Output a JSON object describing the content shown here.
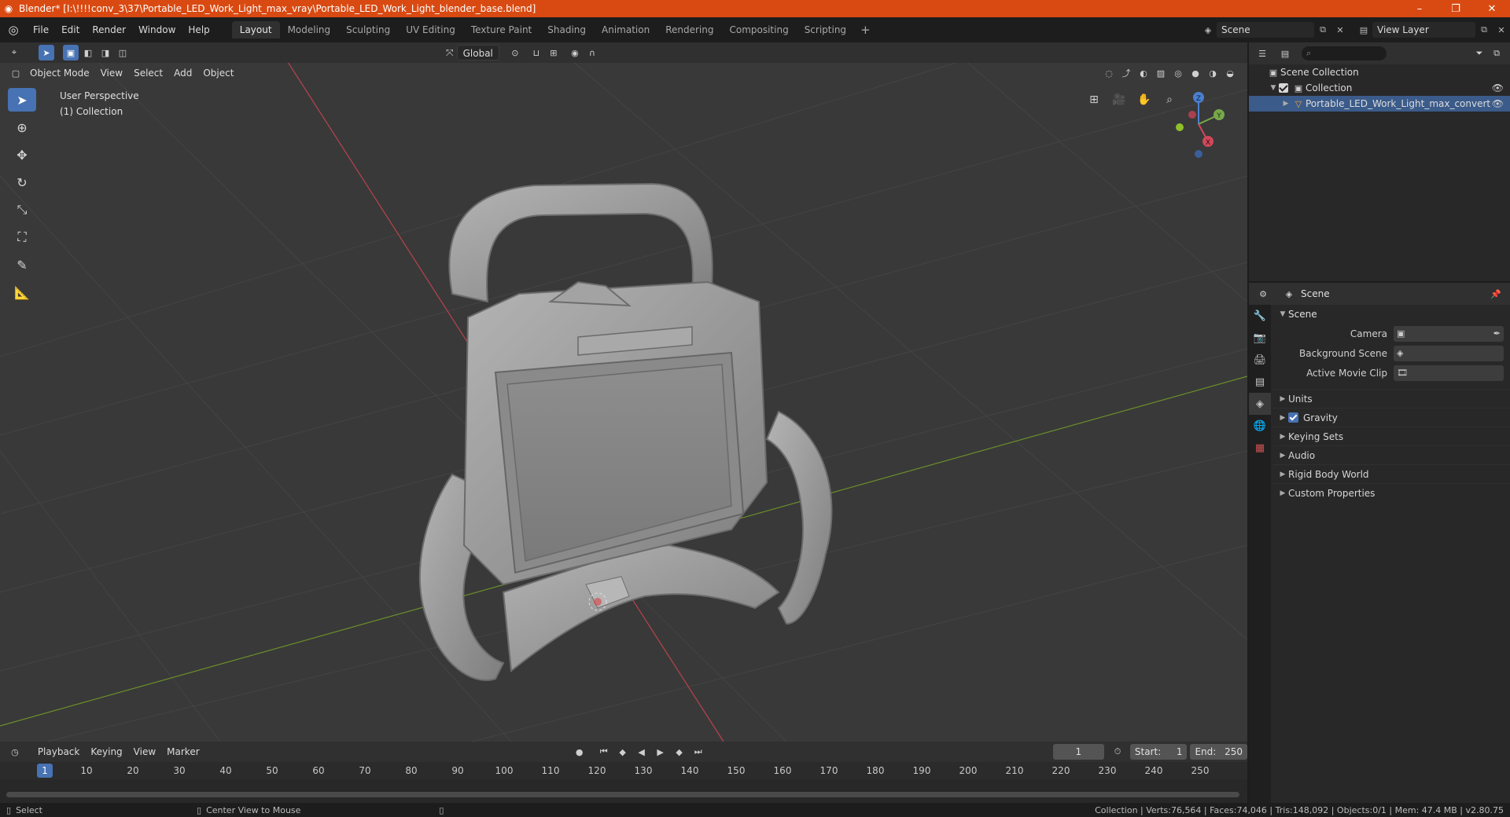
{
  "window": {
    "title": "Blender* [I:\\!!!!conv_3\\37\\Portable_LED_Work_Light_max_vray\\Portable_LED_Work_Light_blender_base.blend]",
    "minimize": "–",
    "maximize": "❐",
    "close": "✕"
  },
  "menu": {
    "items": [
      "File",
      "Edit",
      "Render",
      "Window",
      "Help"
    ]
  },
  "workspaces": {
    "tabs": [
      "Layout",
      "Modeling",
      "Sculpting",
      "UV Editing",
      "Texture Paint",
      "Shading",
      "Animation",
      "Rendering",
      "Compositing",
      "Scripting"
    ],
    "active": "Layout",
    "add": "+"
  },
  "scene_selector": {
    "value": "Scene"
  },
  "viewlayer_selector": {
    "value": "View Layer"
  },
  "viewport": {
    "transform_orientation": "Global",
    "mode": "Object Mode",
    "header_menus": [
      "View",
      "Select",
      "Add",
      "Object"
    ],
    "info_line1": "User Perspective",
    "info_line2": "(1) Collection",
    "gizmo": {
      "x": "X",
      "y": "Y",
      "z": "Z"
    },
    "colors": {
      "bg": "#393939",
      "grid": "#444444",
      "x_axis": "#b8434f",
      "y_axis": "#6b8f2a",
      "model": "#9a9a9a"
    }
  },
  "outliner": {
    "search_placeholder": "⌕",
    "rows": [
      {
        "label": "Scene Collection"
      },
      {
        "label": "Collection"
      },
      {
        "label": "Portable_LED_Work_Light_max_convert"
      }
    ]
  },
  "properties": {
    "context": "Scene",
    "panel": "Scene",
    "camera_label": "Camera",
    "background_scene_label": "Background Scene",
    "active_movie_clip_label": "Active Movie Clip",
    "subpanels": [
      "Units",
      "Gravity",
      "Keying Sets",
      "Audio",
      "Rigid Body World",
      "Custom Properties"
    ],
    "gravity_checked": true
  },
  "timeline": {
    "menus": [
      "Playback",
      "Keying",
      "View",
      "Marker"
    ],
    "current_frame": "1",
    "start_label": "Start:",
    "start_value": "1",
    "end_label": "End:",
    "end_value": "250",
    "frame_ticks": [
      "10",
      "20",
      "30",
      "40",
      "50",
      "60",
      "70",
      "80",
      "90",
      "100",
      "110",
      "120",
      "130",
      "140",
      "150",
      "160",
      "170",
      "180",
      "190",
      "200",
      "210",
      "220",
      "230",
      "240",
      "250"
    ],
    "cursor_label": "1"
  },
  "statusbar": {
    "select": "Select",
    "center_view": "Center View to Mouse",
    "stats": "Collection | Verts:76,564 | Faces:74,046 | Tris:148,092 | Objects:0/1 | Mem: 47.4 MB | v2.80.75"
  }
}
